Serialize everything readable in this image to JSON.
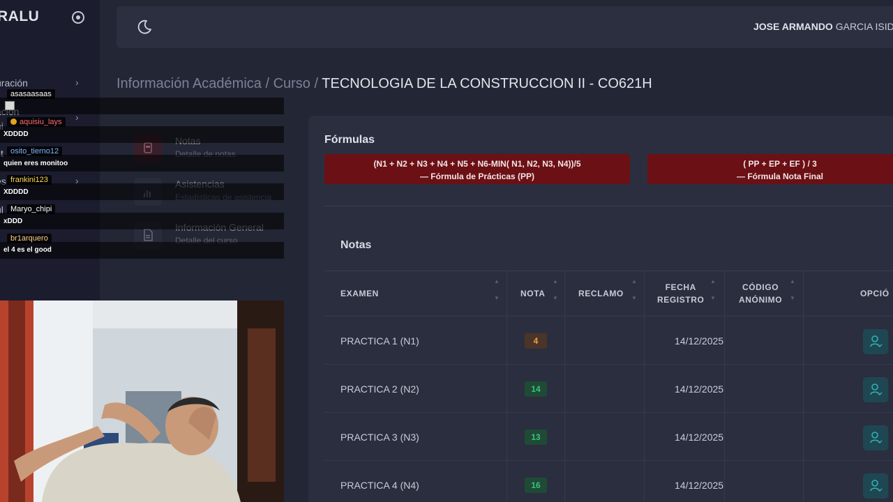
{
  "app": {
    "brand": "RALU",
    "user_first": "JOSE ARMANDO",
    "user_last": "GARCIA ISID"
  },
  "sidebar": {
    "items": [
      {
        "label": "uración"
      },
      {
        "label": "ación"
      },
      {
        "label": "ni"
      },
      {
        "label": "st"
      },
      {
        "label": "es"
      },
      {
        "label": "ul"
      }
    ]
  },
  "breadcrumb": {
    "part1": "Información Académica",
    "sep1": "/",
    "part2": "Curso",
    "sep2": "/",
    "current": "TECNOLOGIA DE LA CONSTRUCCION II - CO621H"
  },
  "midnav": [
    {
      "title": "Notas",
      "subtitle": "Detalle de notas"
    },
    {
      "title": "Asistencias",
      "subtitle": "Estadísticas de asistencia"
    },
    {
      "title": "Información General",
      "subtitle": "Detalle del curso"
    }
  ],
  "chat": [
    {
      "user": "asasaasaas",
      "color": "#ffffff",
      "message": ""
    },
    {
      "user": "aquisiu_lays",
      "color": "#ff6b6b",
      "message": "XDDDD"
    },
    {
      "user": "osito_tierno12",
      "color": "#7fb6ff",
      "message": "quien eres monitoo"
    },
    {
      "user": "frankini123",
      "color": "#ffd84a",
      "message": "XDDDD"
    },
    {
      "user": "Maryo_chipi",
      "color": "#ffffff",
      "message": "xDDD"
    },
    {
      "user": "br1arquero",
      "color": "#ffd08a",
      "message": "el 4 es el good"
    }
  ],
  "formulas": {
    "title": "Fórmulas",
    "pp_expr": "(N1 + N2 + N3 + N4 + N5 + N6-MIN( N1, N2, N3, N4))/5",
    "pp_label": "—  Fórmula de Prácticas (PP)",
    "final_expr": "( PP + EP + EF ) / 3",
    "final_label": "—  Fórmula Nota Final"
  },
  "notas": {
    "title": "Notas",
    "headers": {
      "examen": "EXAMEN",
      "nota": "NOTA",
      "reclamo": "RECLAMO",
      "fecha1": "FECHA",
      "fecha2": "REGISTRO",
      "codigo1": "CÓDIGO",
      "codigo2": "ANÓNIMO",
      "opciones": "OPCIÓ"
    },
    "rows": [
      {
        "examen": "PRACTICA 1 (N1)",
        "nota": "4",
        "fecha": "14/12/2025"
      },
      {
        "examen": "PRACTICA 2 (N2)",
        "nota": "14",
        "fecha": "14/12/2025"
      },
      {
        "examen": "PRACTICA 3 (N3)",
        "nota": "13",
        "fecha": "14/12/2025"
      },
      {
        "examen": "PRACTICA 4 (N4)",
        "nota": "16",
        "fecha": "14/12/2025"
      }
    ]
  },
  "colors": {
    "accent_red": "#6b1015",
    "grade_low": "#f39a4a",
    "grade_pass": "#39c27c",
    "option_icon": "#2fb3b9"
  }
}
